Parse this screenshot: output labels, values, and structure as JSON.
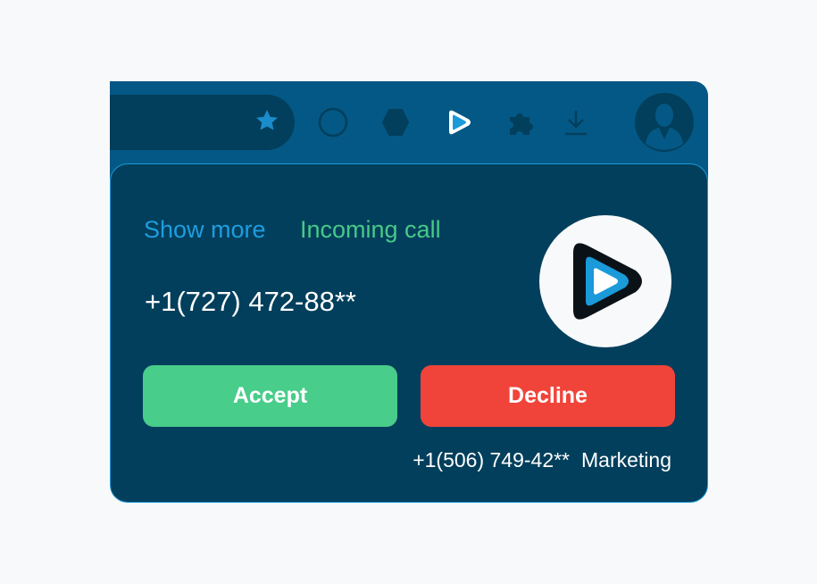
{
  "toolbar": {
    "icons": [
      "star-icon",
      "circle-icon",
      "hexagon-icon",
      "play-logo-icon",
      "puzzle-extension-icon",
      "download-icon",
      "user-avatar-icon"
    ]
  },
  "popup": {
    "show_more_label": "Show more",
    "status_label": "Incoming call",
    "caller_number": "+1(727) 472-88**",
    "accept_label": "Accept",
    "decline_label": "Decline",
    "line_number": "+1(506) 749-42**",
    "line_name": "Marketing"
  },
  "colors": {
    "browser_bar": "#045885",
    "popup_bg": "#023f5c",
    "link": "#1e9de0",
    "status": "#47c988",
    "accept": "#48cd8b",
    "decline": "#f0443a"
  }
}
